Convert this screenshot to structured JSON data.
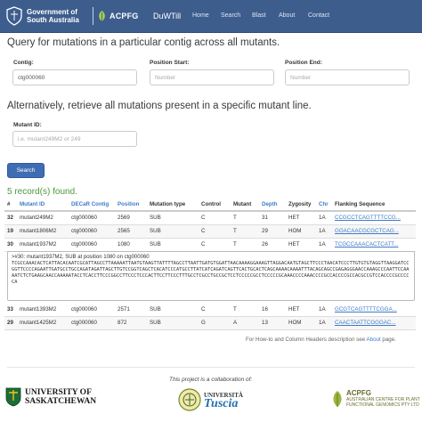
{
  "nav": {
    "gov_line1": "Government of",
    "gov_line2": "South Australia",
    "acpfg": "ACPFG",
    "brand": "DuWTill",
    "links": [
      "Home",
      "Search",
      "Blast",
      "About",
      "Contact"
    ]
  },
  "query_contig": {
    "title": "Query for mutations in a particular contig across all mutants.",
    "contig_label": "Contig:",
    "contig_value": "ctg000060",
    "start_label": "Position Start:",
    "start_placeholder": "Number",
    "end_label": "Position End:",
    "end_placeholder": "Number"
  },
  "query_mutant": {
    "title": "Alternatively, retrieve all mutations present in a specific mutant line.",
    "mutant_label": "Mutant ID:",
    "mutant_placeholder": "i.e. mutant249M2 or 249"
  },
  "search_button": "Search",
  "records_found": "5 record(s) found.",
  "table": {
    "headers": [
      "#",
      "Mutant ID",
      "DECaR Contig",
      "Position",
      "Mutation type",
      "Control",
      "Mutant",
      "Depth",
      "Zygosity",
      "Chr",
      "Flanking Sequence"
    ],
    "rows_top": [
      [
        "32",
        "mutant249M2",
        "ctg000060",
        "2569",
        "SUB",
        "C",
        "T",
        "31",
        "HET",
        "1A",
        "CCGCCTCAGTTTTCCG..."
      ],
      [
        "19",
        "mutant1806M2",
        "ctg000060",
        "2565",
        "SUB",
        "C",
        "T",
        "29",
        "HOM",
        "1A",
        "GGACAACGCGCTCAG..."
      ],
      [
        "30",
        "mutant1937M2",
        "ctg000060",
        "1080",
        "SUB",
        "C",
        "T",
        "26",
        "HET",
        "1A",
        "TCGCCAAACACTCATT..."
      ]
    ],
    "rows_bottom": [
      [
        "33",
        "mutant1393M2",
        "ctg000060",
        "2571",
        "SUB",
        "C",
        "T",
        "16",
        "HET",
        "1A",
        "GCGTCAGTTTTCGGA..."
      ],
      [
        "29",
        "mutant1425M2",
        "ctg000060",
        "872",
        "SUB",
        "G",
        "A",
        "13",
        "HOM",
        "1A",
        "CAACTAATTCGGGAC..."
      ]
    ]
  },
  "detail": {
    "header": ">#30: mutant1937M2, SUB at position 1080 on ctg000060",
    "sequence": "TCGCCAAACACTCATTACACAATCGCATTAGCCTTAAAAATTAATGTAAGTTATTTTAGCCTTAATTGATGTGGATTAACAAAAGGAAAGTTAGGACAATGTAGCTTCCCTAACATCCCTTGTGTGTAGGTTAAGGATCCGGTTCCCCAGAATTGATGCCTGCCAGATAGATTAGCTTGTCCGGTCAGCTCACATCCCATGCCTTATCATCAGATCAGTTCACTGCACTCAGCAAAACAAAATTTACAGCAGCCGAGAGGGAACCAAAGCCCAATTCCAAAATCTCTGAAGCAACCAAAAATACCTCACCTTCCCGGCCTTCCCTCCCACTTCCTTCCCTTTGCCTCGCCTGCCGCTCCTCCCCCGCCTCCCCCGCAAACCCCAAACCCCGCCACCCCGCCACGCCGTCCACCCCGCCCCCA"
  },
  "help": {
    "prefix": "For How-to and Column Headers description see ",
    "link": "About",
    "suffix": " page."
  },
  "footer": {
    "collab": "This project is a collaboration of:",
    "usask_line1": "UNIVERSITY OF",
    "usask_line2": "SASKATCHEWAN",
    "tuscia_line1": "UNIVERSITÀ",
    "tuscia_line2": "Tuscia",
    "acpfg_name": "ACPFG",
    "acpfg_line1": "AUSTRALIAN CENTRE FOR PLANT",
    "acpfg_line2": "FUNCTIONAL GENOMICS PTY LTD"
  }
}
